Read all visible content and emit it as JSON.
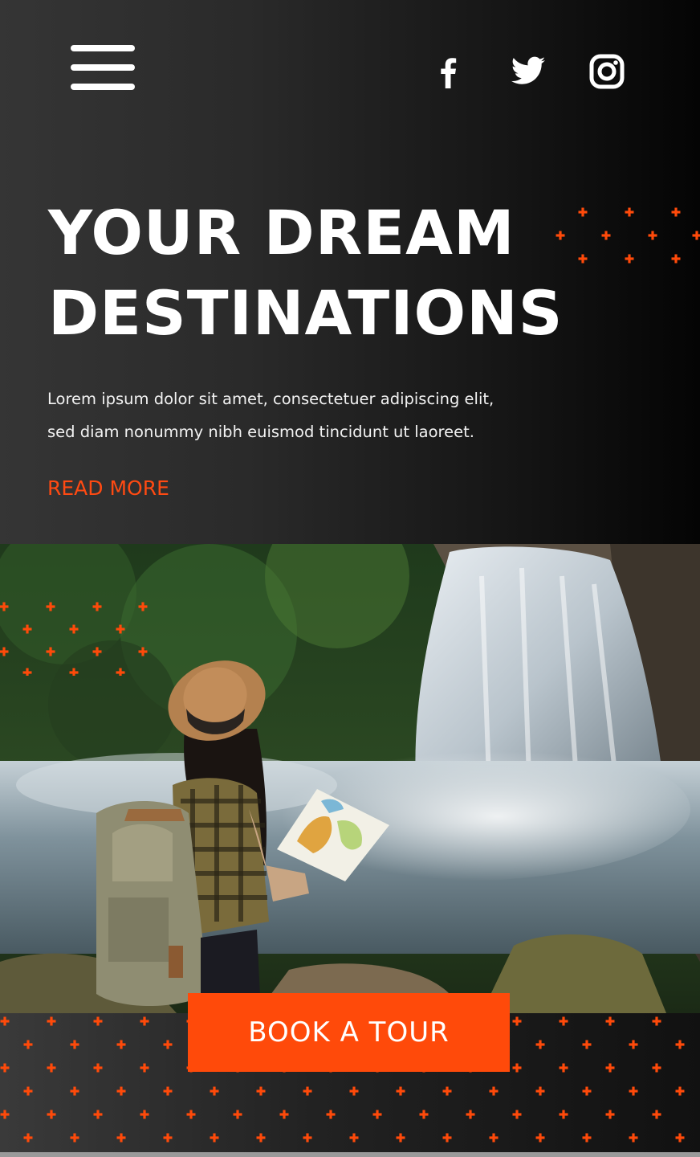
{
  "colors": {
    "accent": "#ff4a0a",
    "text": "#ffffff",
    "background_dark": "#111111"
  },
  "nav": {
    "menu_icon": "hamburger-menu-icon",
    "social": [
      {
        "name": "facebook",
        "icon": "facebook-icon"
      },
      {
        "name": "twitter",
        "icon": "twitter-icon"
      },
      {
        "name": "instagram",
        "icon": "instagram-icon"
      }
    ]
  },
  "hero": {
    "title_line1": "YOUR DREAM",
    "title_line2": "DESTINATIONS",
    "description_line1": "Lorem ipsum dolor sit amet, consectetuer adipiscing elit,",
    "description_line2": "sed diam nonummy nibh euismod tincidunt ut laoreet.",
    "read_more_label": "READ MORE"
  },
  "cta": {
    "book_label": "BOOK A TOUR"
  }
}
